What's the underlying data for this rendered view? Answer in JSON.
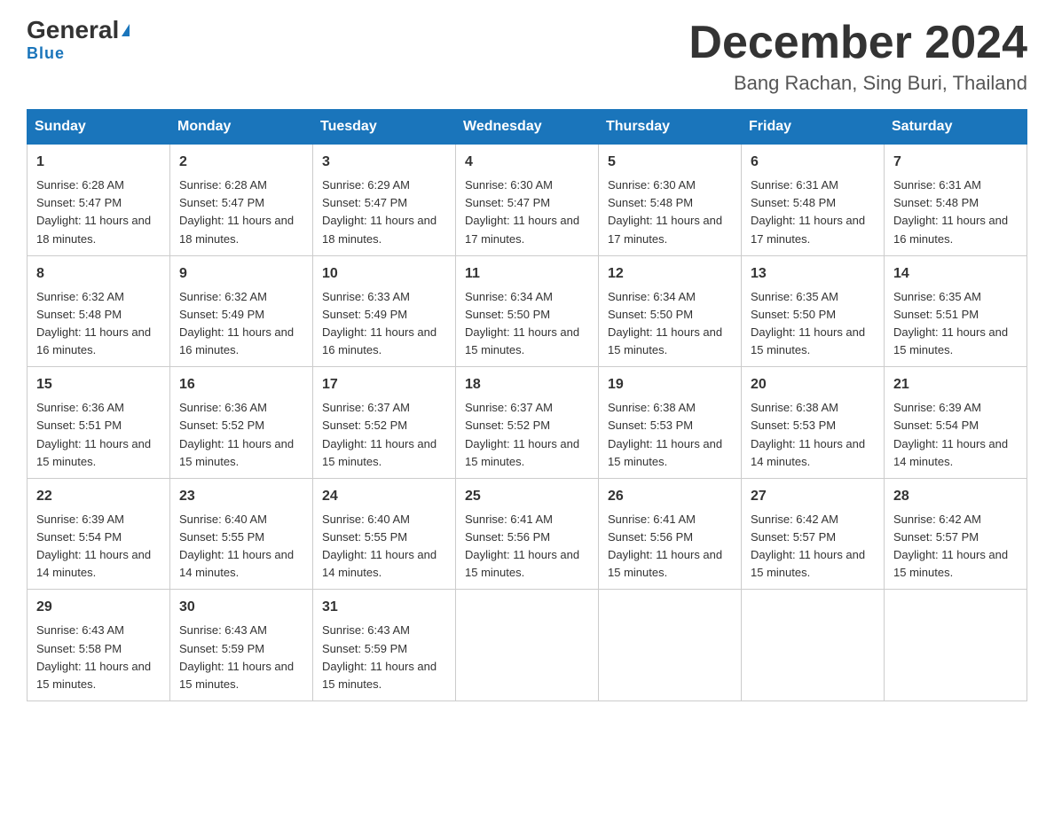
{
  "logo": {
    "general": "General",
    "triangle_symbol": "▶",
    "blue": "Blue"
  },
  "header": {
    "month_year": "December 2024",
    "location": "Bang Rachan, Sing Buri, Thailand"
  },
  "days_of_week": [
    "Sunday",
    "Monday",
    "Tuesday",
    "Wednesday",
    "Thursday",
    "Friday",
    "Saturday"
  ],
  "weeks": [
    [
      {
        "day": "1",
        "sunrise": "6:28 AM",
        "sunset": "5:47 PM",
        "daylight": "11 hours and 18 minutes."
      },
      {
        "day": "2",
        "sunrise": "6:28 AM",
        "sunset": "5:47 PM",
        "daylight": "11 hours and 18 minutes."
      },
      {
        "day": "3",
        "sunrise": "6:29 AM",
        "sunset": "5:47 PM",
        "daylight": "11 hours and 18 minutes."
      },
      {
        "day": "4",
        "sunrise": "6:30 AM",
        "sunset": "5:47 PM",
        "daylight": "11 hours and 17 minutes."
      },
      {
        "day": "5",
        "sunrise": "6:30 AM",
        "sunset": "5:48 PM",
        "daylight": "11 hours and 17 minutes."
      },
      {
        "day": "6",
        "sunrise": "6:31 AM",
        "sunset": "5:48 PM",
        "daylight": "11 hours and 17 minutes."
      },
      {
        "day": "7",
        "sunrise": "6:31 AM",
        "sunset": "5:48 PM",
        "daylight": "11 hours and 16 minutes."
      }
    ],
    [
      {
        "day": "8",
        "sunrise": "6:32 AM",
        "sunset": "5:48 PM",
        "daylight": "11 hours and 16 minutes."
      },
      {
        "day": "9",
        "sunrise": "6:32 AM",
        "sunset": "5:49 PM",
        "daylight": "11 hours and 16 minutes."
      },
      {
        "day": "10",
        "sunrise": "6:33 AM",
        "sunset": "5:49 PM",
        "daylight": "11 hours and 16 minutes."
      },
      {
        "day": "11",
        "sunrise": "6:34 AM",
        "sunset": "5:50 PM",
        "daylight": "11 hours and 15 minutes."
      },
      {
        "day": "12",
        "sunrise": "6:34 AM",
        "sunset": "5:50 PM",
        "daylight": "11 hours and 15 minutes."
      },
      {
        "day": "13",
        "sunrise": "6:35 AM",
        "sunset": "5:50 PM",
        "daylight": "11 hours and 15 minutes."
      },
      {
        "day": "14",
        "sunrise": "6:35 AM",
        "sunset": "5:51 PM",
        "daylight": "11 hours and 15 minutes."
      }
    ],
    [
      {
        "day": "15",
        "sunrise": "6:36 AM",
        "sunset": "5:51 PM",
        "daylight": "11 hours and 15 minutes."
      },
      {
        "day": "16",
        "sunrise": "6:36 AM",
        "sunset": "5:52 PM",
        "daylight": "11 hours and 15 minutes."
      },
      {
        "day": "17",
        "sunrise": "6:37 AM",
        "sunset": "5:52 PM",
        "daylight": "11 hours and 15 minutes."
      },
      {
        "day": "18",
        "sunrise": "6:37 AM",
        "sunset": "5:52 PM",
        "daylight": "11 hours and 15 minutes."
      },
      {
        "day": "19",
        "sunrise": "6:38 AM",
        "sunset": "5:53 PM",
        "daylight": "11 hours and 15 minutes."
      },
      {
        "day": "20",
        "sunrise": "6:38 AM",
        "sunset": "5:53 PM",
        "daylight": "11 hours and 14 minutes."
      },
      {
        "day": "21",
        "sunrise": "6:39 AM",
        "sunset": "5:54 PM",
        "daylight": "11 hours and 14 minutes."
      }
    ],
    [
      {
        "day": "22",
        "sunrise": "6:39 AM",
        "sunset": "5:54 PM",
        "daylight": "11 hours and 14 minutes."
      },
      {
        "day": "23",
        "sunrise": "6:40 AM",
        "sunset": "5:55 PM",
        "daylight": "11 hours and 14 minutes."
      },
      {
        "day": "24",
        "sunrise": "6:40 AM",
        "sunset": "5:55 PM",
        "daylight": "11 hours and 14 minutes."
      },
      {
        "day": "25",
        "sunrise": "6:41 AM",
        "sunset": "5:56 PM",
        "daylight": "11 hours and 15 minutes."
      },
      {
        "day": "26",
        "sunrise": "6:41 AM",
        "sunset": "5:56 PM",
        "daylight": "11 hours and 15 minutes."
      },
      {
        "day": "27",
        "sunrise": "6:42 AM",
        "sunset": "5:57 PM",
        "daylight": "11 hours and 15 minutes."
      },
      {
        "day": "28",
        "sunrise": "6:42 AM",
        "sunset": "5:57 PM",
        "daylight": "11 hours and 15 minutes."
      }
    ],
    [
      {
        "day": "29",
        "sunrise": "6:43 AM",
        "sunset": "5:58 PM",
        "daylight": "11 hours and 15 minutes."
      },
      {
        "day": "30",
        "sunrise": "6:43 AM",
        "sunset": "5:59 PM",
        "daylight": "11 hours and 15 minutes."
      },
      {
        "day": "31",
        "sunrise": "6:43 AM",
        "sunset": "5:59 PM",
        "daylight": "11 hours and 15 minutes."
      },
      null,
      null,
      null,
      null
    ]
  ]
}
